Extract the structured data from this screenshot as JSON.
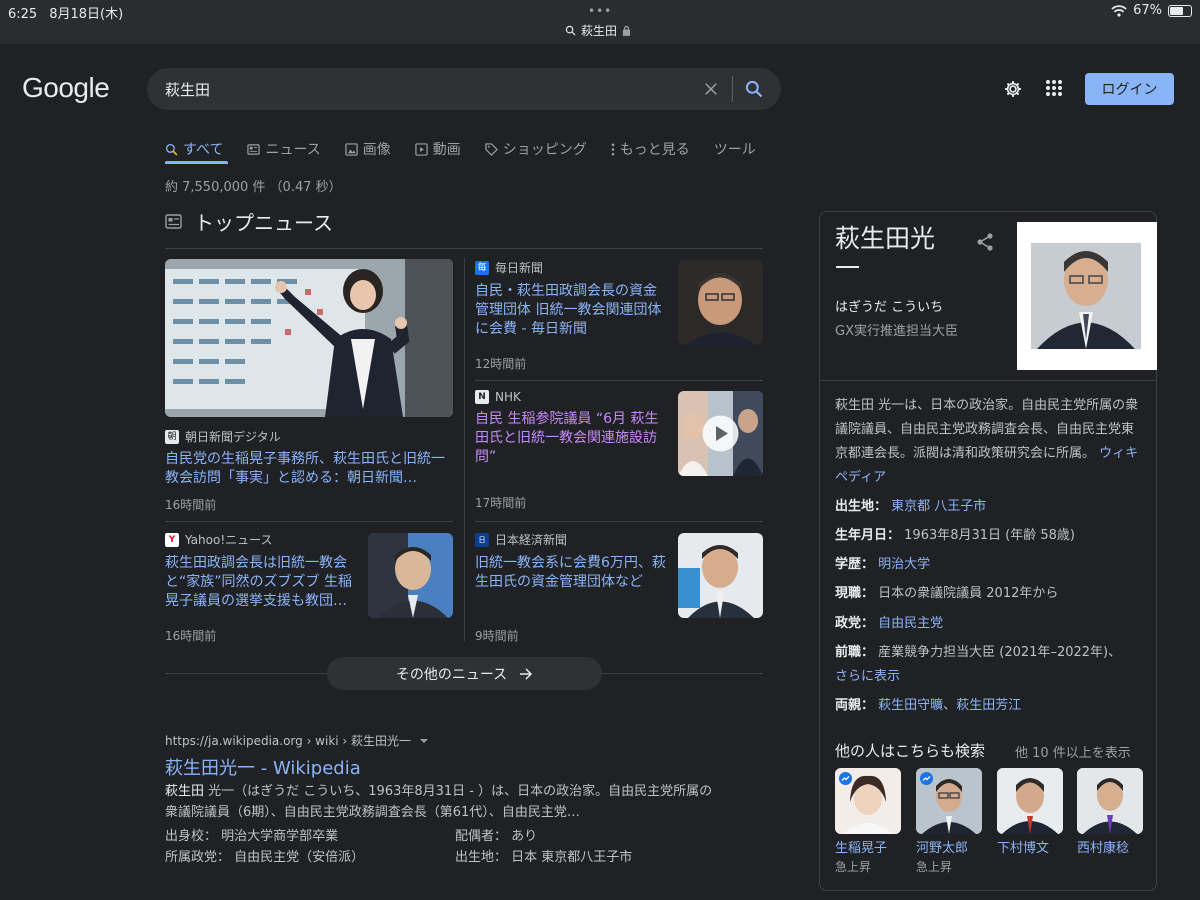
{
  "status_bar": {
    "time": "6:25",
    "date": "8月18日(木)",
    "url": "萩生田",
    "battery": "67%",
    "battery_level": 0.67
  },
  "header": {
    "logo": "Google",
    "query": "萩生田",
    "login_label": "ログイン"
  },
  "tabs": [
    {
      "label": "すべて",
      "icon": "search-icon"
    },
    {
      "label": "ニュース",
      "icon": "news-icon"
    },
    {
      "label": "画像",
      "icon": "image-icon"
    },
    {
      "label": "動画",
      "icon": "video-icon"
    },
    {
      "label": "ショッピング",
      "icon": "tag-icon"
    },
    {
      "label": "もっと見る",
      "icon": "more-vert-icon"
    },
    {
      "label": "ツール",
      "icon": ""
    }
  ],
  "results_count": "約 7,550,000 件 （0.47 秒）",
  "top_news": {
    "title": "トップニュース",
    "more_label": "その他のニュース",
    "featured": {
      "source": "朝日新聞デジタル",
      "title": "自民党の生稲晃子事務所、萩生田氏と旧統一教会訪問「事実」と認める：朝日新聞…",
      "time": "16時間前"
    },
    "items": [
      {
        "source": "毎日新聞",
        "title": "自民・萩生田政調会長の資金管理団体 旧統一教会関連団体に会費 - 毎日新聞",
        "time": "12時間前"
      },
      {
        "source": "NHK",
        "title": "自民 生稲参院議員 “6月 萩生田氏と旧統一教会関連施設訪問”",
        "time": "17時間前"
      },
      {
        "source": "Yahoo!ニュース",
        "title": "萩生田政調会長は旧統一教会と“家族”同然のズブズブ 生稲晃子議員の選挙支援も教団…",
        "time": "16時間前"
      },
      {
        "source": "日本経済新聞",
        "title": "旧統一教会系に会費6万円、萩生田氏の資金管理団体など",
        "time": "9時間前"
      }
    ]
  },
  "wiki_result": {
    "url": "https://ja.wikipedia.org › wiki › 萩生田光一",
    "title": "萩生田光一 - Wikipedia",
    "snippet_bold": "萩生田",
    "snippet": " 光一（はぎうだ こういち、1963年8月31日 - ）は、日本の政治家。自由民主党所属の衆議院議員（6期）、自由民主党政務調査会長（第61代）、自由民主党…",
    "facts": [
      {
        "label": "出身校：",
        "value": "明治大学商学部卒業"
      },
      {
        "label": "配偶者：",
        "value": "あり"
      },
      {
        "label": "所属政党：",
        "value": "自由民主党（安倍派）"
      },
      {
        "label": "出生地：",
        "value": "日本 東京都八王子市"
      }
    ]
  },
  "knowledge_panel": {
    "name": "萩生田光一",
    "reading": "はぎうだ こういち",
    "role": "GX実行推進担当大臣",
    "description": "萩生田 光一は、日本の政治家。自由民主党所属の衆議院議員、自由民主党政務調査会長、自由民主党東京都連会長。派閥は清和政策研究会に所属。",
    "description_link": "ウィキペディア",
    "facts": {
      "birthplace_label": "出生地：",
      "birthplace": "東京都 八王子市",
      "birthdate_label": "生年月日：",
      "birthdate": "1963年8月31日 (年齢 58歳)",
      "education_label": "学歴：",
      "education": "明治大学",
      "current_label": "現職：",
      "current": "日本の衆議院議員 2012年から",
      "party_label": "政党：",
      "party": "自由民主党",
      "previous_label": "前職：",
      "previous": "産業競争力担当大臣 (2021年–2022年)、",
      "show_more": "さらに表示",
      "parents_label": "両親：",
      "parent1": "萩生田守曠",
      "parent_sep": "、",
      "parent2": "萩生田芳江"
    },
    "others_title": "他の人はこちらも検索",
    "others_more": "他 10 件以上を表示",
    "others": [
      {
        "name": "生稲晃子",
        "trend": "急上昇"
      },
      {
        "name": "河野太郎",
        "trend": "急上昇"
      },
      {
        "name": "下村博文",
        "trend": ""
      },
      {
        "name": "西村康稔",
        "trend": ""
      }
    ]
  },
  "colors": {
    "background": "#202124",
    "link": "#8ab4f8",
    "visited": "#c58af9",
    "login_button": "#8ab4f8"
  }
}
